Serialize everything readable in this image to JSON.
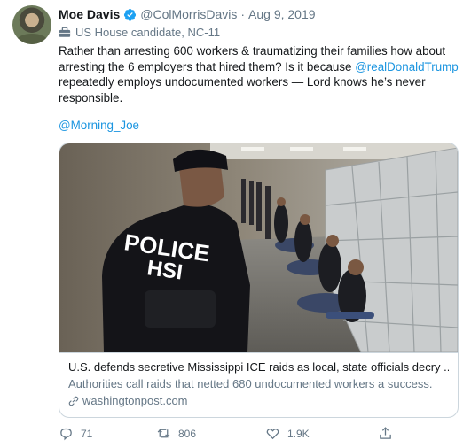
{
  "author": {
    "name": "Moe Davis",
    "handle": "@ColMorrisDavis",
    "separator": "·",
    "date": "Aug 9, 2019",
    "bio": "US House candidate, NC-11"
  },
  "tweet": {
    "text_part1": "Rather than arresting 600 workers & traumatizing their families how about arresting the 6 employers that hired them?  Is it because ",
    "mention1": "@realDonaldTrump",
    "text_part2": " repeatedly employs undocumented workers — Lord knows he’s never responsible.",
    "mention2": "@Morning_Joe"
  },
  "card": {
    "image_text_line1": "POLICE",
    "image_text_line2": "HSI",
    "title": "U.S. defends secretive Mississippi ICE raids as local, state officials decry ...",
    "description": "Authorities call raids that netted 680 undocumented workers a success.",
    "domain": "washingtonpost.com"
  },
  "actions": {
    "replies": "71",
    "retweets": "806",
    "likes": "1.9K"
  },
  "colors": {
    "link": "#1b95e0",
    "secondary_text": "#657786",
    "verified": "#1da1f2"
  },
  "icons": [
    "verified-badge-icon",
    "briefcase-icon",
    "link-icon",
    "reply-icon",
    "retweet-icon",
    "like-icon",
    "share-icon"
  ]
}
